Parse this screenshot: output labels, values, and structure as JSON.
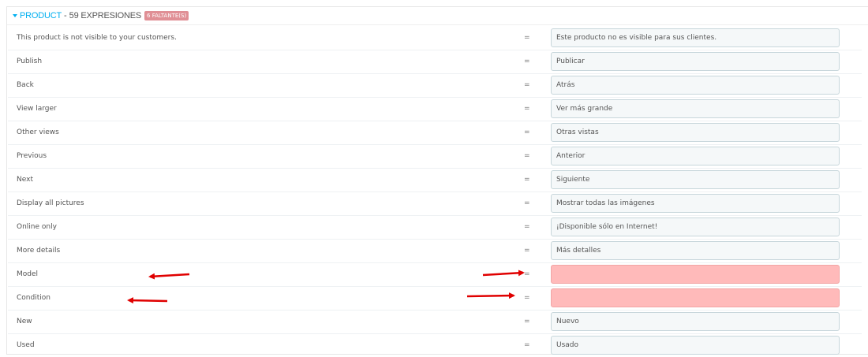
{
  "header": {
    "section": "PRODUCT",
    "separator": "-",
    "count": "59 EXPRESIONES",
    "badge": "6 FALTANTE(S)"
  },
  "rows": [
    {
      "source": "This product is not visible to your customers.",
      "eq": "=",
      "value": "Este producto no es visible para sus clientes.",
      "missing": false
    },
    {
      "source": "Publish",
      "eq": "=",
      "value": "Publicar",
      "missing": false
    },
    {
      "source": "Back",
      "eq": "=",
      "value": "Atrás",
      "missing": false
    },
    {
      "source": "View larger",
      "eq": "=",
      "value": "Ver más grande",
      "missing": false
    },
    {
      "source": "Other views",
      "eq": "=",
      "value": "Otras vistas",
      "missing": false
    },
    {
      "source": "Previous",
      "eq": "=",
      "value": "Anterior",
      "missing": false
    },
    {
      "source": "Next",
      "eq": "=",
      "value": "Siguiente",
      "missing": false
    },
    {
      "source": "Display all pictures",
      "eq": "=",
      "value": "Mostrar todas las imágenes",
      "missing": false
    },
    {
      "source": "Online only",
      "eq": "=",
      "value": "¡Disponible sólo en Internet!",
      "missing": false
    },
    {
      "source": "More details",
      "eq": "=",
      "value": "Más detalles",
      "missing": false
    },
    {
      "source": "Model",
      "eq": "=",
      "value": "",
      "missing": true
    },
    {
      "source": "Condition",
      "eq": "=",
      "value": "",
      "missing": true
    },
    {
      "source": "New",
      "eq": "=",
      "value": "Nuevo",
      "missing": false
    },
    {
      "source": "Used",
      "eq": "=",
      "value": "Usado",
      "missing": false
    }
  ],
  "colors": {
    "accent": "#00aff0",
    "badge": "#e08f95",
    "missing_field": "#ffbaba",
    "annotation_arrow": "#e00000"
  }
}
